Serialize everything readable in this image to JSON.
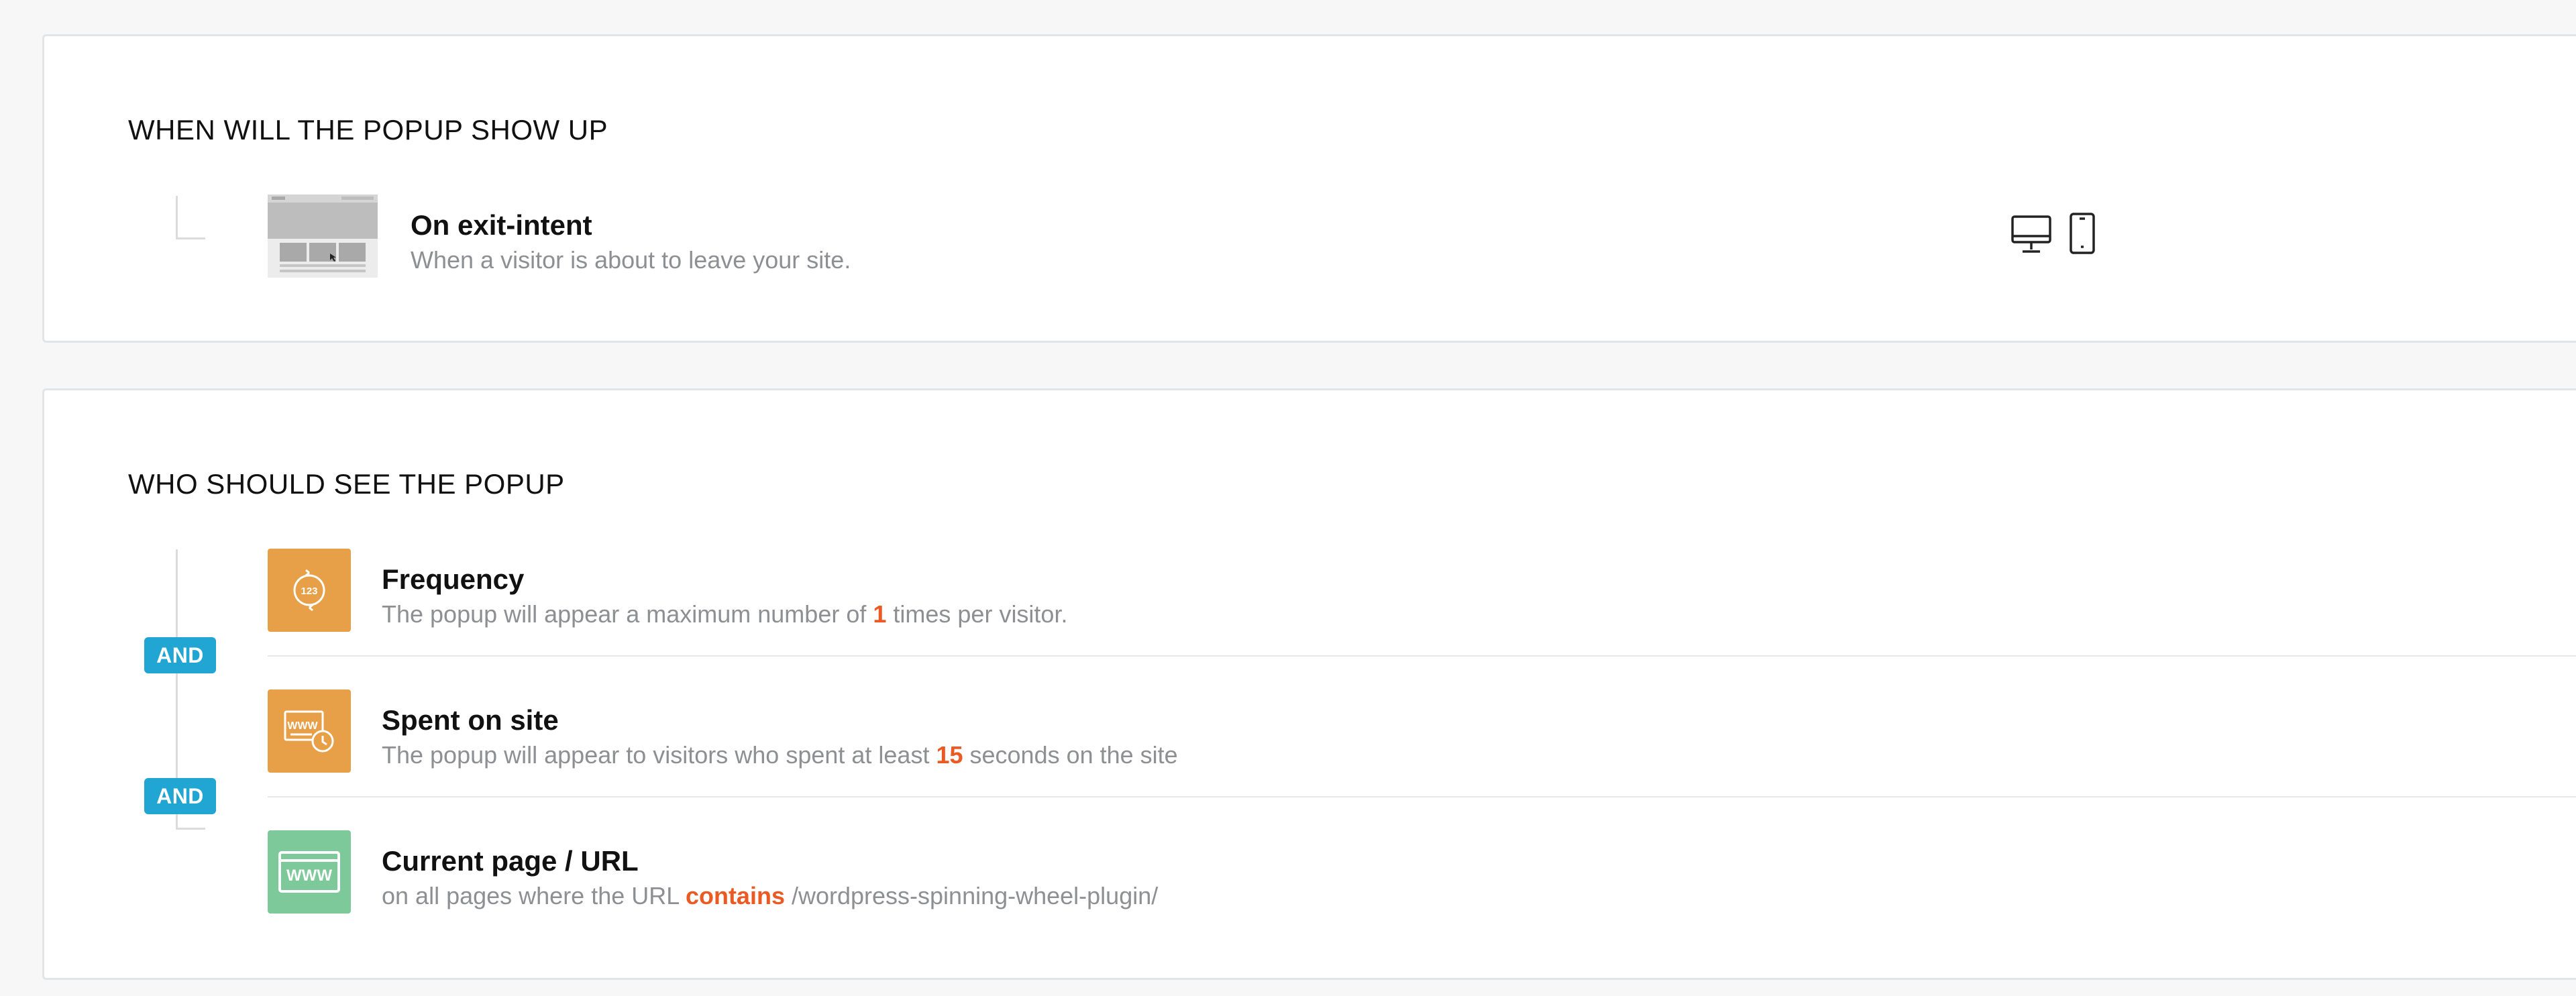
{
  "trigger_section": {
    "title": "WHEN WILL THE POPUP SHOW UP",
    "rule": {
      "icon": "exit-intent-thumbnail-icon",
      "title": "On exit-intent",
      "description": "When a visitor is about to leave your site.",
      "devices": [
        "desktop-icon",
        "mobile-icon"
      ]
    }
  },
  "audience_section": {
    "title": "WHO SHOULD SEE THE POPUP",
    "connector_label_1": "AND",
    "connector_label_2": "AND",
    "rules": [
      {
        "icon": "frequency-icon",
        "title": "Frequency",
        "desc_before": "The popup will appear a maximum number of ",
        "desc_value": "1",
        "desc_after": " times per visitor."
      },
      {
        "icon": "time-on-site-icon",
        "title": "Spent on site",
        "desc_before": "The popup will appear to visitors who spent at least ",
        "desc_value": "15",
        "desc_after": " seconds on the site"
      },
      {
        "icon": "url-icon",
        "title": "Current page / URL",
        "desc_before": "on all pages where the URL ",
        "desc_value": "contains",
        "desc_after": " /wordpress-spinning-wheel-plugin/"
      }
    ]
  },
  "colors": {
    "orange": "#e8a048",
    "green": "#7ec99a",
    "badge_blue": "#21a6d4",
    "highlight": "#ec5a23"
  }
}
